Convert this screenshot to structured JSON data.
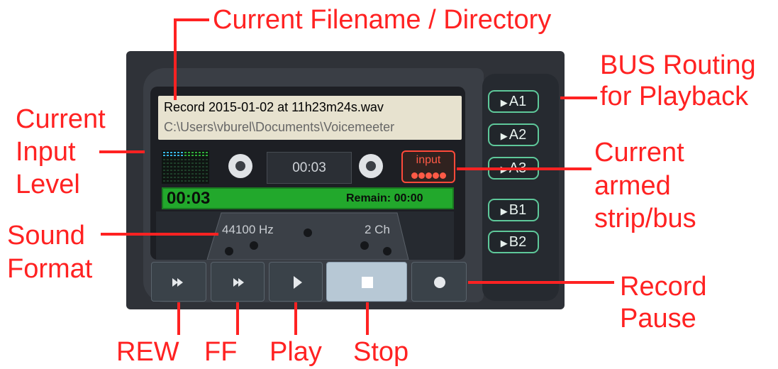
{
  "annotations": {
    "filename_directory": "Current Filename / Directory",
    "bus_routing_line1": "BUS Routing",
    "bus_routing_line2": "for Playback",
    "input_level_line1": "Current",
    "input_level_line2": "Input",
    "input_level_line3": "Level",
    "armed_line1": "Current",
    "armed_line2": "armed",
    "armed_line3": "strip/bus",
    "sound_format_line1": "Sound",
    "sound_format_line2": "Format",
    "record_pause_line1": "Record",
    "record_pause_line2": "Pause",
    "rew": "REW",
    "ff": "FF",
    "play": "Play",
    "stop": "Stop"
  },
  "file": {
    "name": "Record 2015-01-02 at 11h23m24s.wav",
    "directory": "C:\\Users\\vburel\\Documents\\Voicemeeter"
  },
  "counter": "00:03",
  "armed": {
    "label": "input"
  },
  "progress": {
    "elapsed": "00:03",
    "remain": "Remain: 00:00"
  },
  "format": {
    "rate": "44100 Hz",
    "channels": "2 Ch"
  },
  "bus_buttons": [
    "A1",
    "A2",
    "A3",
    "B1",
    "B2"
  ],
  "colors": {
    "annotation": "#ff2222",
    "progress": "#22a82c",
    "armed": "#ff5a46",
    "bus_border": "#5ec89a"
  },
  "icons": {
    "rew": "rewind-icon",
    "ff": "fast-forward-icon",
    "play": "play-icon",
    "stop": "stop-icon",
    "record": "record-icon"
  }
}
